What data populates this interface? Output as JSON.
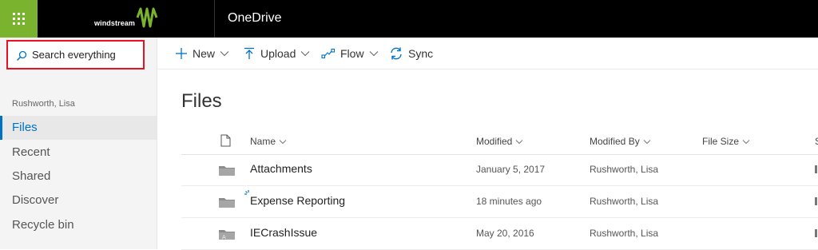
{
  "suite": {
    "brand": "windstream",
    "app_title": "OneDrive",
    "colors": {
      "waffle": "#7ab32e",
      "bar": "#000000"
    }
  },
  "search": {
    "label": "Search everything"
  },
  "nav": {
    "owner": "Rushworth, Lisa",
    "items": [
      {
        "label": "Files",
        "active": true
      },
      {
        "label": "Recent"
      },
      {
        "label": "Shared"
      },
      {
        "label": "Discover"
      },
      {
        "label": "Recycle bin"
      }
    ]
  },
  "commands": [
    {
      "label": "New",
      "icon": "plus-icon"
    },
    {
      "label": "Upload",
      "icon": "upload-icon"
    },
    {
      "label": "Flow",
      "icon": "flow-icon"
    },
    {
      "label": "Sync",
      "icon": "sync-icon"
    }
  ],
  "page_title": "Files",
  "columns": {
    "name": "Name",
    "modified": "Modified",
    "modified_by": "Modified By",
    "file_size": "File Size",
    "sharing": "S"
  },
  "rows": [
    {
      "name": "Attachments",
      "modified": "January 5, 2017",
      "modified_by": "Rushworth, Lisa",
      "icon": "folder-icon"
    },
    {
      "name": "Expense Reporting",
      "modified": "18 minutes ago",
      "modified_by": "Rushworth, Lisa",
      "icon": "folder-icon"
    },
    {
      "name": "IECrashIssue",
      "modified": "May 20, 2016",
      "modified_by": "Rushworth, Lisa",
      "icon": "shared-folder-icon"
    }
  ]
}
